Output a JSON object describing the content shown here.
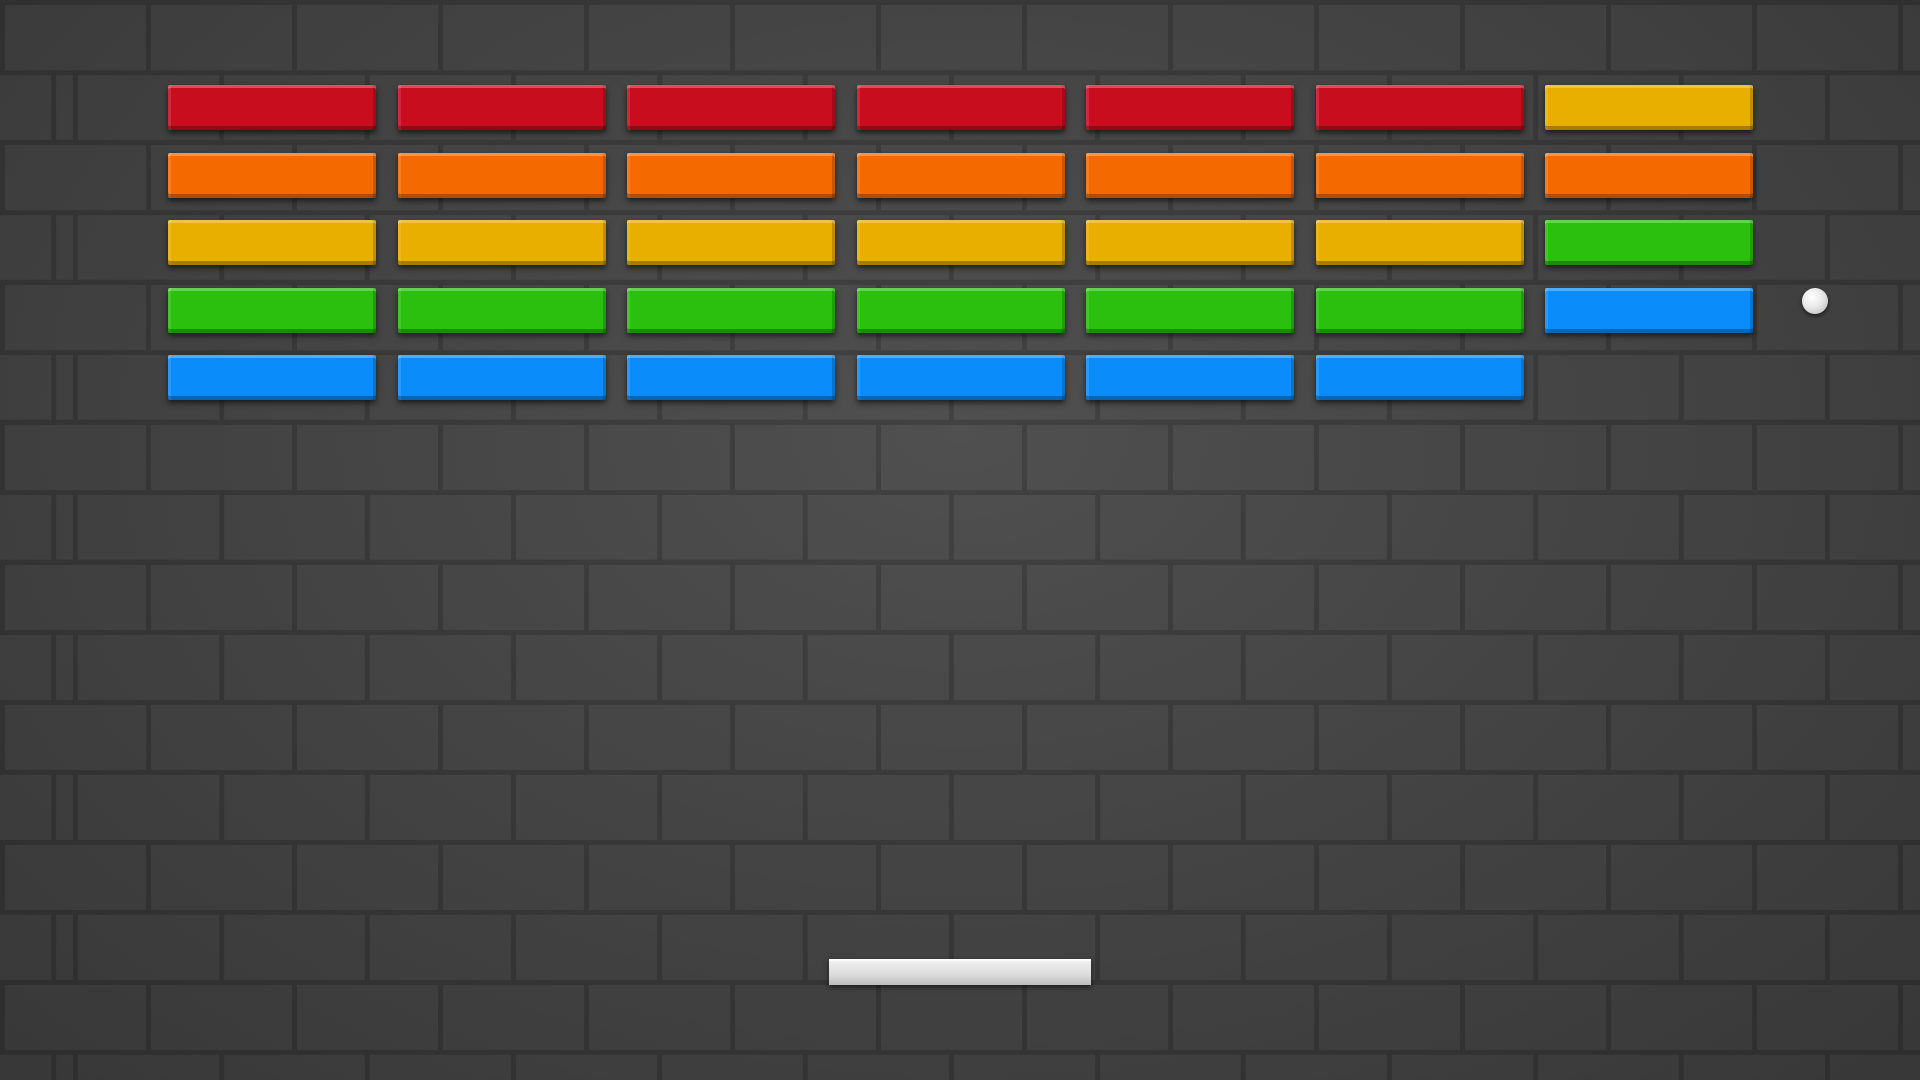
{
  "game": {
    "name": "brick-breaker",
    "wall_style": "dark-brick-wall"
  },
  "colors": {
    "red": "#c80d1e",
    "orange": "#f56a00",
    "yellow": "#e8ae00",
    "green": "#2bbf0e",
    "blue": "#0a8dfb",
    "ball": "#f0f0f0",
    "paddle": "#e4e4e4"
  },
  "bricks": {
    "columns": 7,
    "rows": [
      [
        "red",
        "red",
        "red",
        "red",
        "red",
        "red",
        "yellow"
      ],
      [
        "orange",
        "orange",
        "orange",
        "orange",
        "orange",
        "orange",
        "orange"
      ],
      [
        "yellow",
        "yellow",
        "yellow",
        "yellow",
        "yellow",
        "yellow",
        "green"
      ],
      [
        "green",
        "green",
        "green",
        "green",
        "green",
        "green",
        "blue"
      ],
      [
        "blue",
        "blue",
        "blue",
        "blue",
        "blue",
        "blue",
        null
      ]
    ]
  }
}
